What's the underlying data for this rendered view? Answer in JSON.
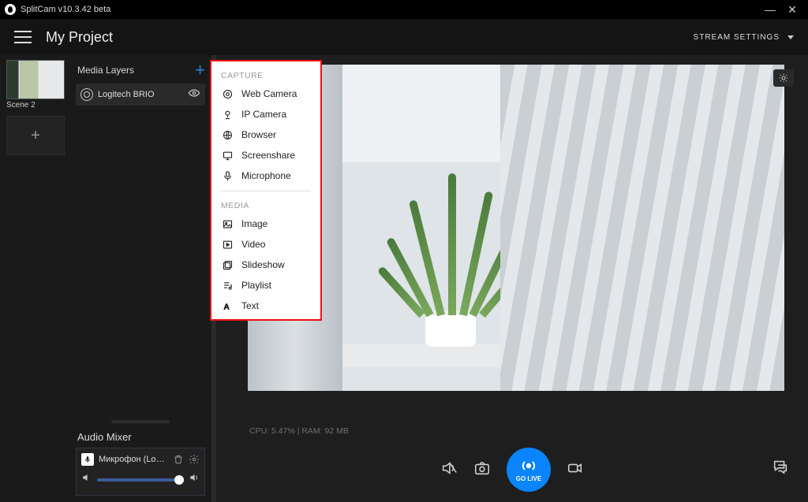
{
  "titlebar": {
    "title": "SplitCam v10.3.42 beta"
  },
  "header": {
    "project": "My Project",
    "stream_settings": "STREAM SETTINGS"
  },
  "scenes": {
    "items": [
      {
        "label": "Scene 2"
      }
    ]
  },
  "media_layers": {
    "title": "Media Layers",
    "layers": [
      {
        "label": "Logitech BRIO"
      }
    ]
  },
  "audio_mixer": {
    "title": "Audio Mixer",
    "tracks": [
      {
        "label": "Микрофон  (Logitech..."
      }
    ]
  },
  "dropdown": {
    "capture_header": "CAPTURE",
    "media_header": "MEDIA",
    "capture": [
      {
        "id": "webcam",
        "label": "Web Camera"
      },
      {
        "id": "ipcam",
        "label": "IP Camera"
      },
      {
        "id": "browser",
        "label": "Browser"
      },
      {
        "id": "screenshare",
        "label": "Screenshare"
      },
      {
        "id": "microphone",
        "label": "Microphone"
      }
    ],
    "media": [
      {
        "id": "image",
        "label": "Image"
      },
      {
        "id": "video",
        "label": "Video"
      },
      {
        "id": "slideshow",
        "label": "Slideshow"
      },
      {
        "id": "playlist",
        "label": "Playlist"
      },
      {
        "id": "text",
        "label": "Text"
      }
    ]
  },
  "status": {
    "text": "CPU: 5.47% | RAM: 92 MB"
  },
  "toolbar": {
    "golive": "GO LIVE"
  }
}
